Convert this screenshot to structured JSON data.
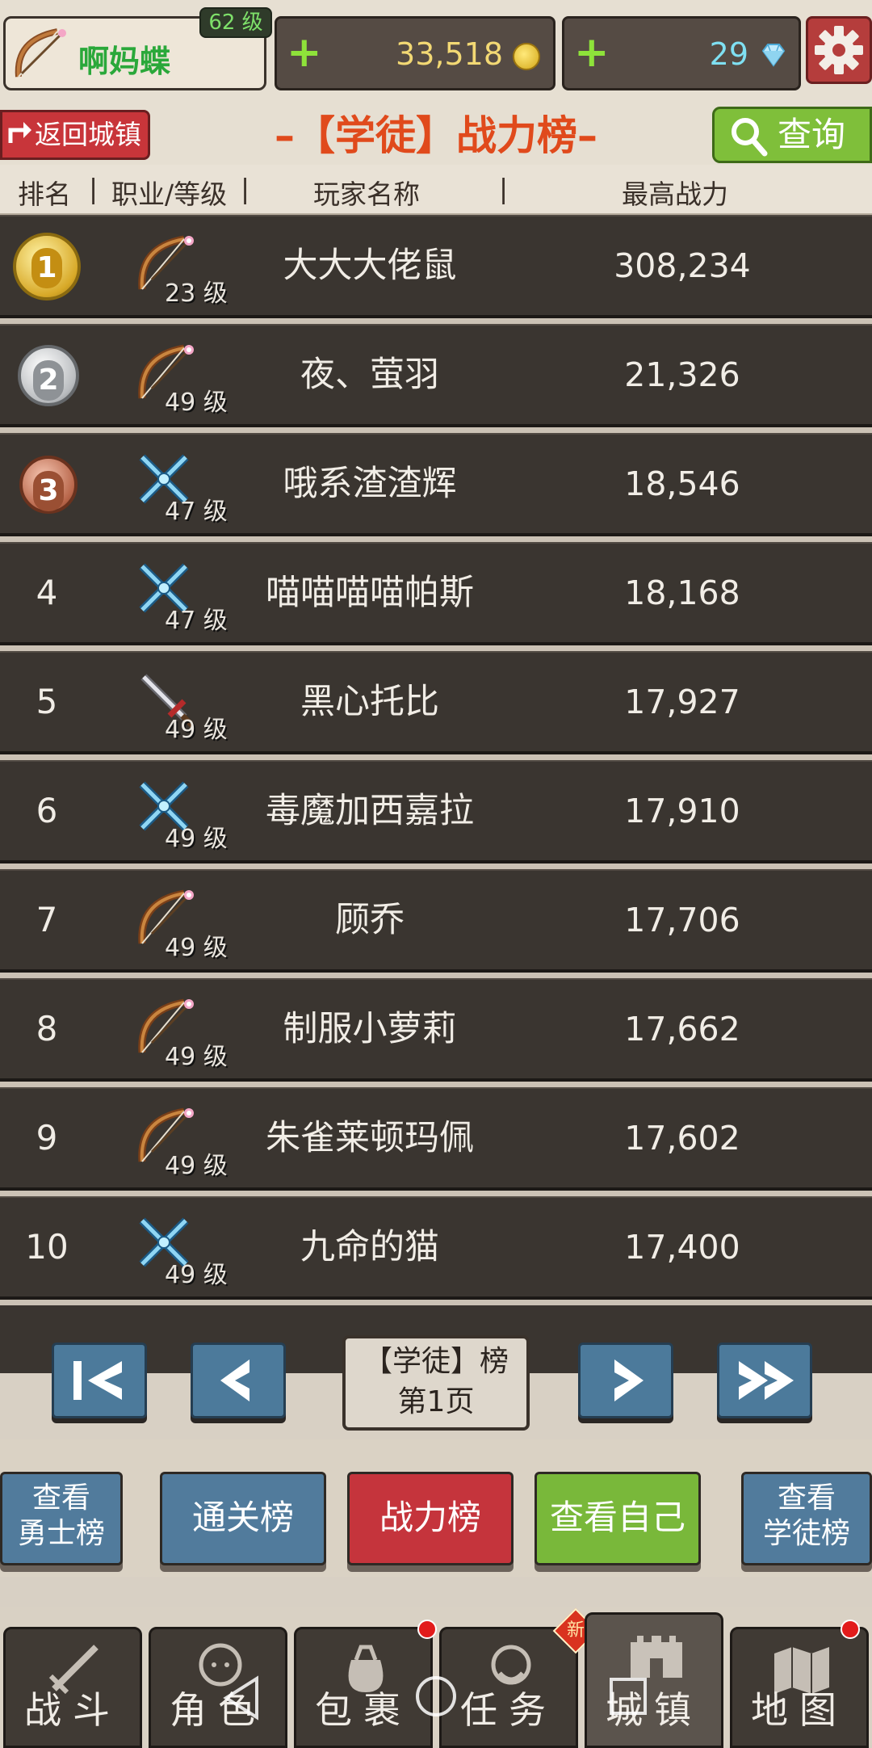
{
  "top": {
    "player_name": "啊妈蝶",
    "player_level": "62 级",
    "gold": "33,518",
    "gems": "29",
    "plus": "+"
  },
  "header": {
    "back_label": "返回城镇",
    "title": "–【学徒】战力榜–",
    "query_label": "查询"
  },
  "columns": {
    "rank": "排名",
    "class_level": "职业/等级",
    "player": "玩家名称",
    "power": "最高战力"
  },
  "rows": [
    {
      "rank": "1",
      "medal": "gold",
      "class_icon": "bow-icon",
      "level": "23 级",
      "player": "大大大佬鼠",
      "power": "308,234"
    },
    {
      "rank": "2",
      "medal": "silver",
      "class_icon": "bow-icon",
      "level": "49 级",
      "player": "夜、萤羽",
      "power": "21,326"
    },
    {
      "rank": "3",
      "medal": "bronze",
      "class_icon": "crossed-swords-icon",
      "level": "47 级",
      "player": "哦系渣渣辉",
      "power": "18,546"
    },
    {
      "rank": "4",
      "class_icon": "crossed-swords-icon",
      "level": "47 级",
      "player": "喵喵喵喵帕斯",
      "power": "18,168"
    },
    {
      "rank": "5",
      "class_icon": "greatsword-icon",
      "level": "49 级",
      "player": "黑心托比",
      "power": "17,927"
    },
    {
      "rank": "6",
      "class_icon": "crossed-swords-icon",
      "level": "49 级",
      "player": "毒魔加西嘉拉",
      "power": "17,910"
    },
    {
      "rank": "7",
      "class_icon": "bow-icon",
      "level": "49 级",
      "player": "顾乔",
      "power": "17,706"
    },
    {
      "rank": "8",
      "class_icon": "bow-icon",
      "level": "49 级",
      "player": "制服小萝莉",
      "power": "17,662"
    },
    {
      "rank": "9",
      "class_icon": "bow-icon",
      "level": "49 级",
      "player": "朱雀莱顿玛佩",
      "power": "17,602"
    },
    {
      "rank": "10",
      "class_icon": "crossed-swords-icon",
      "level": "49 级",
      "player": "九命的猫",
      "power": "17,400"
    }
  ],
  "pager": {
    "line1": "【学徒】榜",
    "line2": "第1页"
  },
  "actions": {
    "warrior_line1": "查看",
    "warrior_line2": "勇士榜",
    "clear": "通关榜",
    "power": "战力榜",
    "self": "查看自己",
    "apprentice_line1": "查看",
    "apprentice_line2": "学徒榜"
  },
  "nav": {
    "battle": "战斗",
    "character": "角色",
    "bag": "包裹",
    "quest": "任务",
    "town": "城镇",
    "map": "地图",
    "new_badge": "新"
  },
  "colors": {
    "title": "#e04a1c",
    "back_button": "#c8353a",
    "query_button": "#7fbf3a",
    "active_action": "#c5343c",
    "row_bg": "#3a3530"
  }
}
